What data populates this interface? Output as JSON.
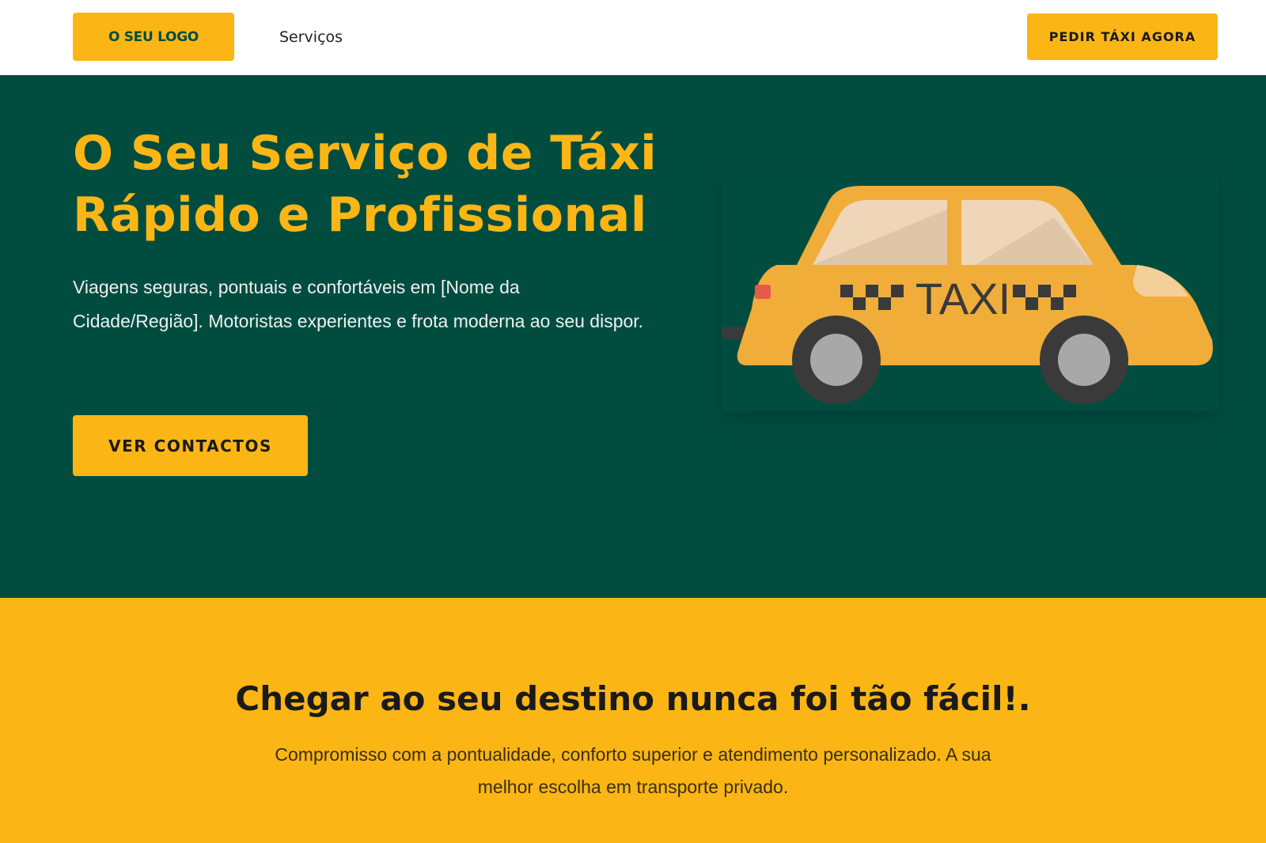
{
  "header": {
    "logo_label": "O SEU LOGO",
    "nav_services": "Serviços",
    "cta_label": "PEDIR TÁXI AGORA"
  },
  "hero": {
    "title_line1": "O Seu Serviço de Táxi",
    "title_line2": "Rápido e Profissional",
    "description": "Viagens seguras, pontuais e confortáveis em [Nome da Cidade/Região]. Motoristas experientes e frota moderna ao seu dispor.",
    "button_label": "VER CONTACTOS",
    "taxi_sign": "TAXI"
  },
  "band": {
    "title": "Chegar ao seu destino nunca foi tão fácil!.",
    "text": "Compromisso com a pontualidade, conforto superior e atendimento personalizado. A sua melhor escolha em transporte privado."
  },
  "colors": {
    "accent": "#fbb615",
    "hero_bg": "#004d40",
    "taxi_body": "#f0ad3a",
    "wheel": "#3a3a3a"
  }
}
